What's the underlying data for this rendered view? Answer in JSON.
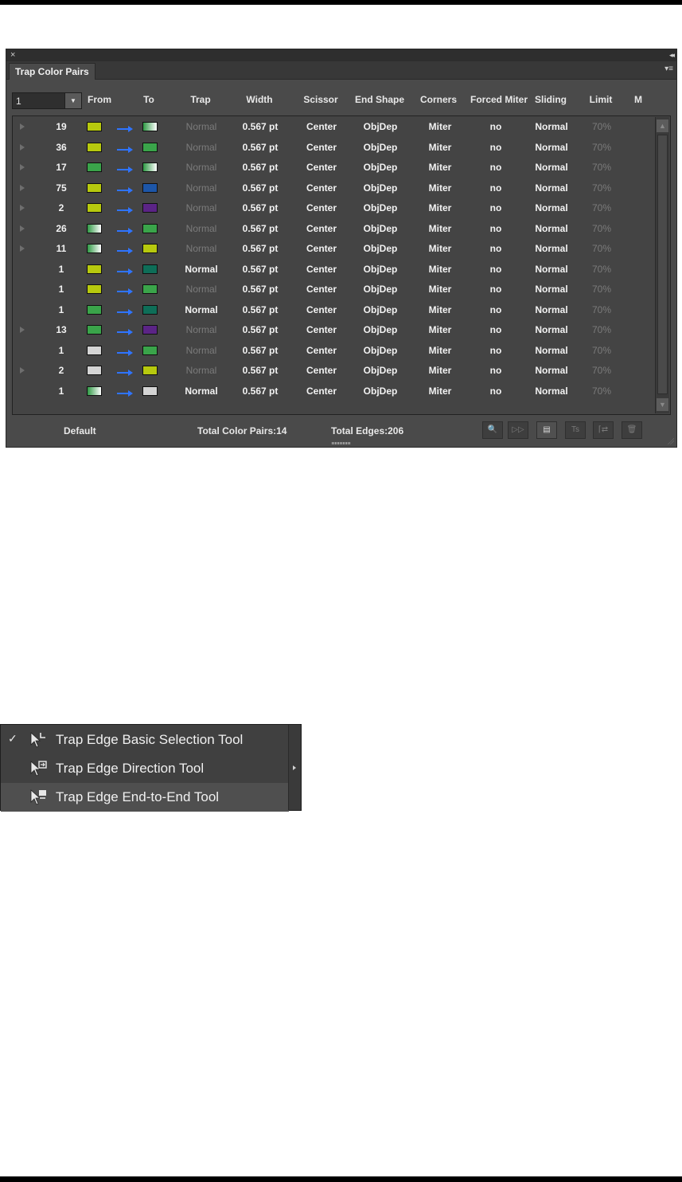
{
  "panel": {
    "close_glyph": "×",
    "collapse_glyph": "◂◂",
    "tab_title": "Trap Color Pairs",
    "menu_glyph": "▾≡",
    "level_value": "1",
    "dropdown_glyph": "▼",
    "columns": [
      "From",
      "To",
      "Trap",
      "Width",
      "Scissor",
      "End Shape",
      "Corners",
      "Forced Miter",
      "Sliding",
      "Limit",
      "M"
    ],
    "rows": [
      {
        "count": "19",
        "expandable": true,
        "from": "yellow-green",
        "to": "green-gradient",
        "trap": "Normal",
        "trap_bold": false,
        "width": "0.567 pt",
        "scissor": "Center",
        "end_shape": "ObjDep",
        "corners": "Miter",
        "forced_miter": "no",
        "sliding": "Normal",
        "limit": "70%"
      },
      {
        "count": "36",
        "expandable": true,
        "from": "yellow-green",
        "to": "green",
        "trap": "Normal",
        "trap_bold": false,
        "width": "0.567 pt",
        "scissor": "Center",
        "end_shape": "ObjDep",
        "corners": "Miter",
        "forced_miter": "no",
        "sliding": "Normal",
        "limit": "70%"
      },
      {
        "count": "17",
        "expandable": true,
        "from": "green",
        "to": "green-gradient",
        "trap": "Normal",
        "trap_bold": false,
        "width": "0.567 pt",
        "scissor": "Center",
        "end_shape": "ObjDep",
        "corners": "Miter",
        "forced_miter": "no",
        "sliding": "Normal",
        "limit": "70%"
      },
      {
        "count": "75",
        "expandable": true,
        "from": "yellow-green",
        "to": "blue",
        "trap": "Normal",
        "trap_bold": false,
        "width": "0.567 pt",
        "scissor": "Center",
        "end_shape": "ObjDep",
        "corners": "Miter",
        "forced_miter": "no",
        "sliding": "Normal",
        "limit": "70%"
      },
      {
        "count": "2",
        "expandable": true,
        "from": "yellow-green",
        "to": "purple",
        "trap": "Normal",
        "trap_bold": false,
        "width": "0.567 pt",
        "scissor": "Center",
        "end_shape": "ObjDep",
        "corners": "Miter",
        "forced_miter": "no",
        "sliding": "Normal",
        "limit": "70%"
      },
      {
        "count": "26",
        "expandable": true,
        "from": "green-gradient",
        "to": "green",
        "trap": "Normal",
        "trap_bold": false,
        "width": "0.567 pt",
        "scissor": "Center",
        "end_shape": "ObjDep",
        "corners": "Miter",
        "forced_miter": "no",
        "sliding": "Normal",
        "limit": "70%"
      },
      {
        "count": "11",
        "expandable": true,
        "from": "green-gradient",
        "to": "yellow-green",
        "trap": "Normal",
        "trap_bold": false,
        "width": "0.567 pt",
        "scissor": "Center",
        "end_shape": "ObjDep",
        "corners": "Miter",
        "forced_miter": "no",
        "sliding": "Normal",
        "limit": "70%"
      },
      {
        "count": "1",
        "expandable": false,
        "from": "yellow-green",
        "to": "teal",
        "trap": "Normal",
        "trap_bold": true,
        "width": "0.567 pt",
        "scissor": "Center",
        "end_shape": "ObjDep",
        "corners": "Miter",
        "forced_miter": "no",
        "sliding": "Normal",
        "limit": "70%"
      },
      {
        "count": "1",
        "expandable": false,
        "from": "yellow-green",
        "to": "green",
        "trap": "Normal",
        "trap_bold": false,
        "width": "0.567 pt",
        "scissor": "Center",
        "end_shape": "ObjDep",
        "corners": "Miter",
        "forced_miter": "no",
        "sliding": "Normal",
        "limit": "70%"
      },
      {
        "count": "1",
        "expandable": false,
        "from": "green",
        "to": "teal",
        "trap": "Normal",
        "trap_bold": true,
        "width": "0.567 pt",
        "scissor": "Center",
        "end_shape": "ObjDep",
        "corners": "Miter",
        "forced_miter": "no",
        "sliding": "Normal",
        "limit": "70%"
      },
      {
        "count": "13",
        "expandable": true,
        "from": "green",
        "to": "purple",
        "trap": "Normal",
        "trap_bold": false,
        "width": "0.567 pt",
        "scissor": "Center",
        "end_shape": "ObjDep",
        "corners": "Miter",
        "forced_miter": "no",
        "sliding": "Normal",
        "limit": "70%"
      },
      {
        "count": "1",
        "expandable": false,
        "from": "light-gray",
        "to": "green",
        "trap": "Normal",
        "trap_bold": false,
        "width": "0.567 pt",
        "scissor": "Center",
        "end_shape": "ObjDep",
        "corners": "Miter",
        "forced_miter": "no",
        "sliding": "Normal",
        "limit": "70%"
      },
      {
        "count": "2",
        "expandable": true,
        "from": "light-gray",
        "to": "yellow-green",
        "trap": "Normal",
        "trap_bold": false,
        "width": "0.567 pt",
        "scissor": "Center",
        "end_shape": "ObjDep",
        "corners": "Miter",
        "forced_miter": "no",
        "sliding": "Normal",
        "limit": "70%"
      },
      {
        "count": "1",
        "expandable": false,
        "from": "green-gradient",
        "to": "light-gray",
        "trap": "Normal",
        "trap_bold": true,
        "width": "0.567 pt",
        "scissor": "Center",
        "end_shape": "ObjDep",
        "corners": "Miter",
        "forced_miter": "no",
        "sliding": "Normal",
        "limit": "70%"
      }
    ],
    "status": {
      "style_label": "Default",
      "pairs_label": "Total Color Pairs:14",
      "edges_label": "Total Edges:206"
    },
    "toolbar_icons": [
      "zoom-icon",
      "fast-forward-icon",
      "list-view-icon",
      "trap-style-icon",
      "swap-trap-icon",
      "trash-icon"
    ],
    "toolbar_glyphs": [
      "🔍",
      "▷▷",
      "▤",
      "Ts",
      "⌈⇄",
      "🗑"
    ]
  },
  "swatch_colors": {
    "yellow-green": "#b7c90e",
    "green": "#3aa44a",
    "teal": "#0e6e58",
    "blue": "#1d56a8",
    "purple": "#5b2486",
    "light-gray": "#d4d4d4",
    "green-gradient": "linear-gradient(90deg, #2f9a45 0%, #ffffff 100%)",
    "arrow_blue": "#2f74ff"
  },
  "tool_menu": {
    "items": [
      {
        "label": "Trap Edge Basic Selection Tool",
        "checked": true,
        "check_glyph": "✓",
        "icon": "trap-edge-basic-selection-icon",
        "highlighted": false
      },
      {
        "label": "Trap Edge Direction Tool",
        "checked": false,
        "check_glyph": "",
        "icon": "trap-edge-direction-icon",
        "highlighted": false
      },
      {
        "label": "Trap Edge End-to-End Tool",
        "checked": false,
        "check_glyph": "",
        "icon": "trap-edge-end-to-end-icon",
        "highlighted": true
      }
    ]
  }
}
